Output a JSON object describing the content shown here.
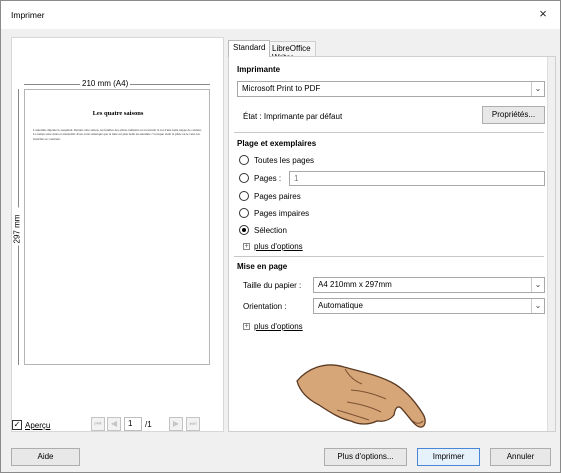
{
  "window": {
    "title": "Imprimer",
    "close": "×"
  },
  "preview": {
    "width_label": "210 mm (A4)",
    "height_label": "297 mm",
    "page_title": "Les quatre saisons",
    "page_text": "L'automne déjoule le soupmoir. Durant cette saison, les feuilles des arbres tombent et recouvrent le sol d'une belle nappe de couleur. Le temps reste doux et ensoleillé. Avez-vous remarqué que la lune est plus belle en automne ? Lorsque vient la pluie ou le vent, les branches se courbent."
  },
  "bottom_left": {
    "apercu_label": "Aperçu",
    "apercu_checked": "✓",
    "page_current": "1",
    "page_total": "/1"
  },
  "tabs": [
    {
      "label": "Standard"
    },
    {
      "label": "LibreOffice Writer"
    }
  ],
  "imprimante": {
    "heading": "Imprimante",
    "printer": "Microsoft Print to PDF",
    "state_label": "État : Imprimante par défaut",
    "properties_button": "Propriétés..."
  },
  "plage": {
    "heading": "Plage et exemplaires",
    "options": [
      {
        "label": "Toutes les pages"
      },
      {
        "label": "Pages :"
      },
      {
        "label": "Pages paires"
      },
      {
        "label": "Pages impaires"
      },
      {
        "label": "Sélection"
      }
    ],
    "pages_value": "1",
    "more_options": "plus d'options"
  },
  "mise_en_page": {
    "heading": "Mise en page",
    "paper_label": "Taille du papier :",
    "paper_value": "A4 210mm x 297mm",
    "orientation_label": "Orientation :",
    "orientation_value": "Automatique",
    "more_options": "plus d'options"
  },
  "buttons": {
    "help": "Aide",
    "more_options": "Plus d'options...",
    "print": "Imprimer",
    "cancel": "Annuler"
  }
}
